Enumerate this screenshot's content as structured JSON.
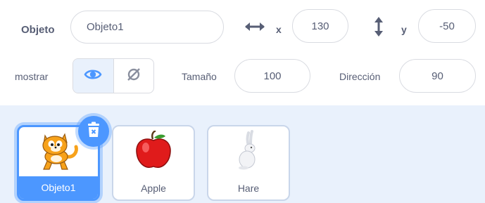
{
  "info": {
    "sprite_label": "Objeto",
    "sprite_name": "Objeto1",
    "x_label": "x",
    "x_value": "130",
    "y_label": "y",
    "y_value": "-50",
    "show_label": "mostrar",
    "size_label": "Tamaño",
    "size_value": "100",
    "direction_label": "Dirección",
    "direction_value": "90",
    "icons": {
      "x": "horizontal-arrows-icon",
      "y": "vertical-arrows-icon",
      "show": "eye-icon",
      "hide": "eye-slash-icon"
    }
  },
  "sprites": [
    {
      "name": "Objeto1",
      "selected": true,
      "icon": "cat-sprite-icon"
    },
    {
      "name": "Apple",
      "selected": false,
      "icon": "apple-sprite-icon"
    },
    {
      "name": "Hare",
      "selected": false,
      "icon": "hare-sprite-icon"
    }
  ],
  "colors": {
    "accent": "#4c97ff",
    "text": "#575e75",
    "panel": "#e9f1fc"
  }
}
